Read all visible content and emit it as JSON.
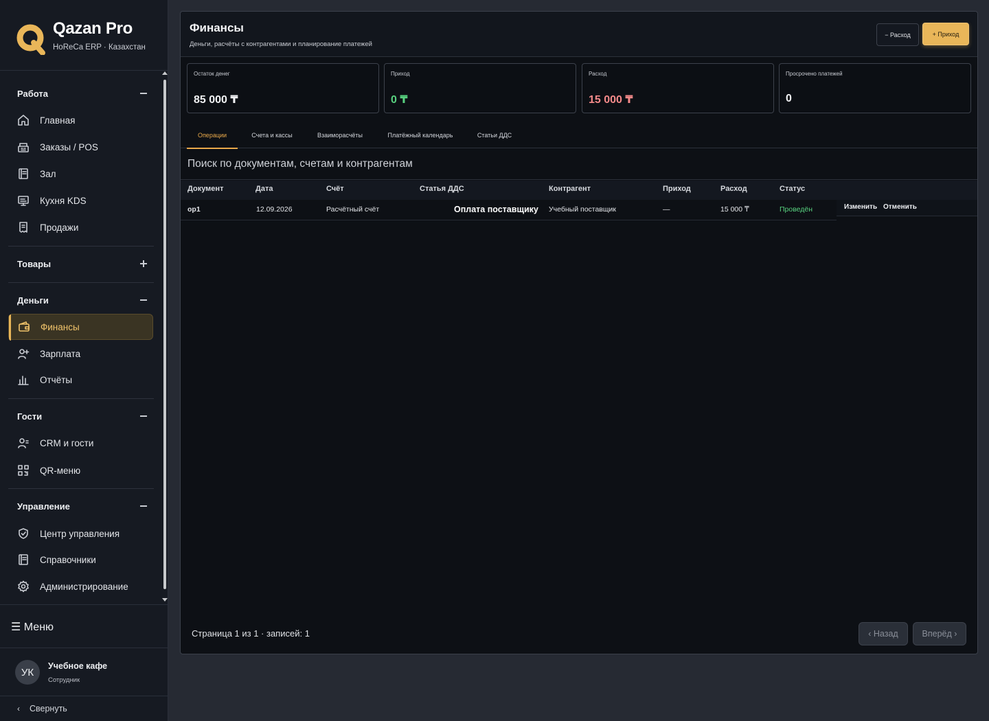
{
  "brand": {
    "title": "Qazan Pro",
    "subtitle": "HoReCa ERP · Казахстан",
    "logo_letter": "Q",
    "accent": "#e9b659"
  },
  "sidebar": {
    "sections": [
      {
        "title": "Работа",
        "toggle": "collapse",
        "items": [
          {
            "label": "Главная",
            "icon": "home-icon"
          },
          {
            "label": "Заказы / POS",
            "icon": "register-icon"
          },
          {
            "label": "Зал",
            "icon": "book-icon"
          },
          {
            "label": "Кухня KDS",
            "icon": "monitor-icon"
          },
          {
            "label": "Продажи",
            "icon": "receipt-icon"
          }
        ]
      },
      {
        "title": "Товары",
        "toggle": "expand",
        "items": []
      },
      {
        "title": "Деньги",
        "toggle": "collapse",
        "items": [
          {
            "label": "Финансы",
            "icon": "wallet-icon",
            "active": true
          },
          {
            "label": "Зарплата",
            "icon": "user-plus-icon"
          },
          {
            "label": "Отчёты",
            "icon": "bar-chart-icon"
          }
        ]
      },
      {
        "title": "Гости",
        "toggle": "collapse",
        "items": [
          {
            "label": "CRM и гости",
            "icon": "user-list-icon"
          },
          {
            "label": "QR-меню",
            "icon": "qr-icon"
          }
        ]
      },
      {
        "title": "Управление",
        "toggle": "collapse",
        "items": [
          {
            "label": "Центр управления",
            "icon": "shield-icon"
          },
          {
            "label": "Справочники",
            "icon": "book-icon"
          },
          {
            "label": "Администрирование",
            "icon": "gear-icon"
          }
        ]
      }
    ],
    "menu_label": "☰ Меню",
    "user": {
      "initials": "УК",
      "name": "Учебное кафе",
      "role": "Сотрудник"
    },
    "collapse_label": "Свернуть"
  },
  "page": {
    "title": "Финансы",
    "subtitle": "Деньги, расчёты с контрагентами и планирование платежей",
    "expense_button": "− Расход",
    "income_button": "+ Приход"
  },
  "kpis": [
    {
      "label": "Остаток денег",
      "value": "85 000 ₸",
      "color": "#f2f3f5"
    },
    {
      "label": "Приход",
      "value": "0 ₸",
      "color": "#58d17f"
    },
    {
      "label": "Расход",
      "value": "15 000 ₸",
      "color": "#f48a8a"
    },
    {
      "label": "Просрочено платежей",
      "value": "0",
      "color": "#f2f3f5"
    }
  ],
  "tabs": [
    {
      "label": "Операции",
      "active": true
    },
    {
      "label": "Счета и кассы"
    },
    {
      "label": "Взаиморасчёты"
    },
    {
      "label": "Платёжный календарь"
    },
    {
      "label": "Статьи ДДС"
    }
  ],
  "search": {
    "placeholder": "Поиск по документам, счетам и контрагентам"
  },
  "table": {
    "columns": [
      "Документ",
      "Дата",
      "Счёт",
      "Статья ДДС",
      "Контрагент",
      "Приход",
      "Расход",
      "Статус"
    ],
    "rows": [
      {
        "document": "op1",
        "date": "12.09.2026",
        "account": "Расчётный счёт",
        "article": "Оплата поставщику",
        "counterparty": "Учебный поставщик",
        "income": "—",
        "expense": "15 000 ₸",
        "status": "Проведён",
        "edit": "Изменить",
        "cancel": "Отменить"
      }
    ]
  },
  "pagination": {
    "summary": "Страница 1 из 1 · записей: 1",
    "prev": "‹ Назад",
    "next": "Вперёд ›"
  }
}
